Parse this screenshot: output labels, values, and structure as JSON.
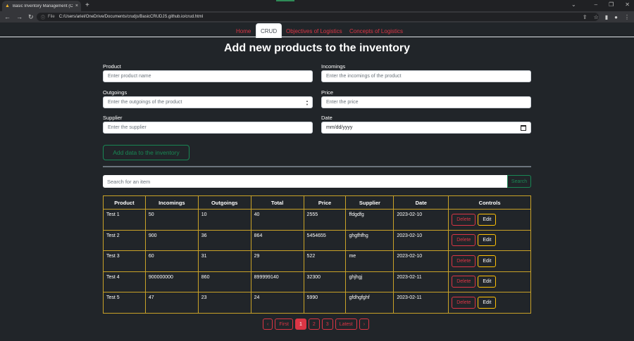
{
  "browser": {
    "tab_title": "Basic Inventory Management (CR",
    "omnibox_scheme": "File",
    "url": "C:/Users/ariel/OneDrive/Documents/crudjs/BasicCRUDJS.github.io/crud.html"
  },
  "nav": {
    "tabs": [
      {
        "label": "Home"
      },
      {
        "label": "CRUD"
      },
      {
        "label": "Objectives of Logistics"
      },
      {
        "label": "Concepts of Logistics"
      }
    ],
    "active": "CRUD"
  },
  "form": {
    "title": "Add new products to the inventory",
    "product_label": "Product",
    "product_placeholder": "Enter product name",
    "incomings_label": "Incomings",
    "incomings_placeholder": "Enter the incomings of the product",
    "outgoings_label": "Outgoings",
    "outgoings_placeholder": "Enter the outgoings of the product",
    "price_label": "Price",
    "price_placeholder": "Enter the price",
    "supplier_label": "Supplier",
    "supplier_placeholder": "Enter the supplier",
    "date_label": "Date",
    "date_placeholder": "mm/dd/yyyy",
    "add_button": "Add data to the inventory"
  },
  "search": {
    "placeholder": "Search for an item",
    "button": "Search"
  },
  "table": {
    "headers": [
      "Product",
      "Incomings",
      "Outgoings",
      "Total",
      "Price",
      "Supplier",
      "Date",
      "Controls"
    ],
    "rows": [
      [
        "Test 1",
        "50",
        "10",
        "40",
        "2555",
        "ffdgdfg",
        "2023-02-10"
      ],
      [
        "Test 2",
        "900",
        "36",
        "864",
        "5454655",
        "ghgfhfhg",
        "2023-02-10"
      ],
      [
        "Test 3",
        "60",
        "31",
        "29",
        "522",
        "me",
        "2023-02-10"
      ],
      [
        "Test 4",
        "900000000",
        "860",
        "899999140",
        "32300",
        "ghjhgj",
        "2023-02-11"
      ],
      [
        "Test 5",
        "47",
        "23",
        "24",
        "5990",
        "gfdhgfghf",
        "2023-02-11"
      ]
    ],
    "delete_label": "Delete",
    "edit_label": "Edit"
  },
  "pagination": {
    "prev": "‹",
    "first": "First",
    "pages": [
      "1",
      "2",
      "3"
    ],
    "current": "1",
    "latest": "Latest",
    "next": "›"
  },
  "colors": {
    "danger": "#dc3545",
    "success": "#198754",
    "warning": "#ffc107",
    "table_border": "#c9a227",
    "background": "#212529"
  },
  "icons": [
    "back-icon",
    "forward-icon",
    "reload-icon",
    "info-icon",
    "share-icon",
    "star-icon",
    "sidepanel-icon",
    "profile-icon",
    "menu-icon",
    "calendar-icon"
  ]
}
